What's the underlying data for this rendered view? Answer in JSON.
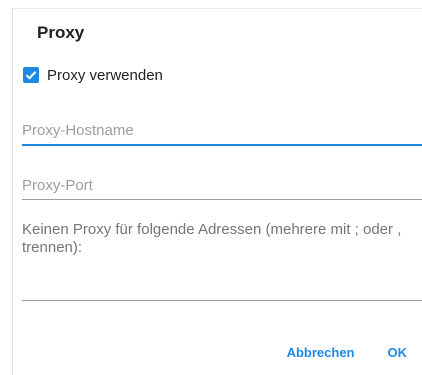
{
  "dialog": {
    "title": "Proxy",
    "use_proxy": {
      "label": "Proxy verwenden",
      "checked": true
    },
    "hostname": {
      "placeholder": "Proxy-Hostname",
      "value": ""
    },
    "port": {
      "placeholder": "Proxy-Port",
      "value": ""
    },
    "exclude": {
      "label": "Keinen Proxy für folgende Adressen (mehrere mit ; oder , trennen):",
      "value": ""
    },
    "buttons": {
      "cancel": "Abbrechen",
      "ok": "OK"
    }
  },
  "colors": {
    "accent": "#1e88e5",
    "text": "#212121",
    "hint": "#9e9e9e"
  },
  "icons": {
    "checkbox": "check-icon"
  }
}
